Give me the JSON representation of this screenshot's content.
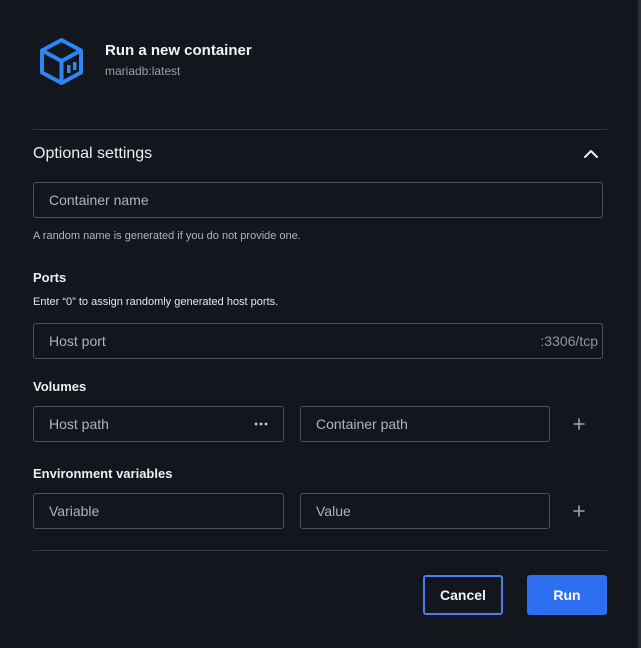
{
  "header": {
    "title": "Run a new container",
    "subtitle": "mariadb:latest",
    "icon": "cube-icon"
  },
  "optional_settings": {
    "title": "Optional settings",
    "expanded": true
  },
  "container_name": {
    "placeholder": "Container name",
    "value": "",
    "helper": "A random name is generated if you do not provide one."
  },
  "ports": {
    "label": "Ports",
    "helper": "Enter “0” to assign randomly generated host ports.",
    "host_port_placeholder": "Host port",
    "container_port_suffix": ":3306/tcp"
  },
  "volumes": {
    "label": "Volumes",
    "host_path_placeholder": "Host path",
    "container_path_placeholder": "Container path"
  },
  "env": {
    "label": "Environment variables",
    "variable_placeholder": "Variable",
    "value_placeholder": "Value"
  },
  "actions": {
    "cancel_label": "Cancel",
    "run_label": "Run"
  },
  "colors": {
    "accent": "#2e6ff2",
    "background": "#13161c",
    "border": "#4b535f"
  }
}
